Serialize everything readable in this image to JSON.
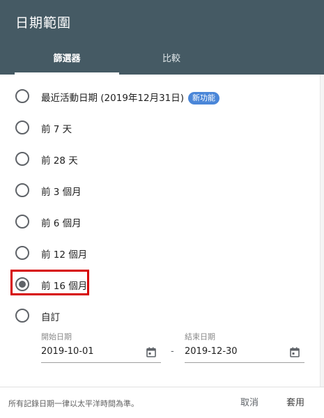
{
  "dialog": {
    "title": "日期範圍",
    "tabs": [
      {
        "label": "篩選器",
        "active": true
      },
      {
        "label": "比較",
        "active": false
      }
    ]
  },
  "options": [
    {
      "label": "最近活動日期 (2019年12月31日)",
      "badge": "新功能",
      "selected": false
    },
    {
      "label": "前 7 天",
      "selected": false
    },
    {
      "label": "前 28 天",
      "selected": false
    },
    {
      "label": "前 3 個月",
      "selected": false
    },
    {
      "label": "前 6 個月",
      "selected": false
    },
    {
      "label": "前 12 個月",
      "selected": false
    },
    {
      "label": "前 16 個月",
      "selected": true
    },
    {
      "label": "自訂",
      "selected": false
    }
  ],
  "custom_range": {
    "start_label": "開始日期",
    "start_value": "2019-10-01",
    "separator": "-",
    "end_label": "結束日期",
    "end_value": "2019-12-30"
  },
  "footer": {
    "note": "所有記錄日期一律以太平洋時間為準。",
    "cancel_label": "取消",
    "apply_label": "套用"
  },
  "colors": {
    "header_bg": "#455a64",
    "badge_bg": "#4a86d8",
    "highlight_border": "#d60000"
  }
}
